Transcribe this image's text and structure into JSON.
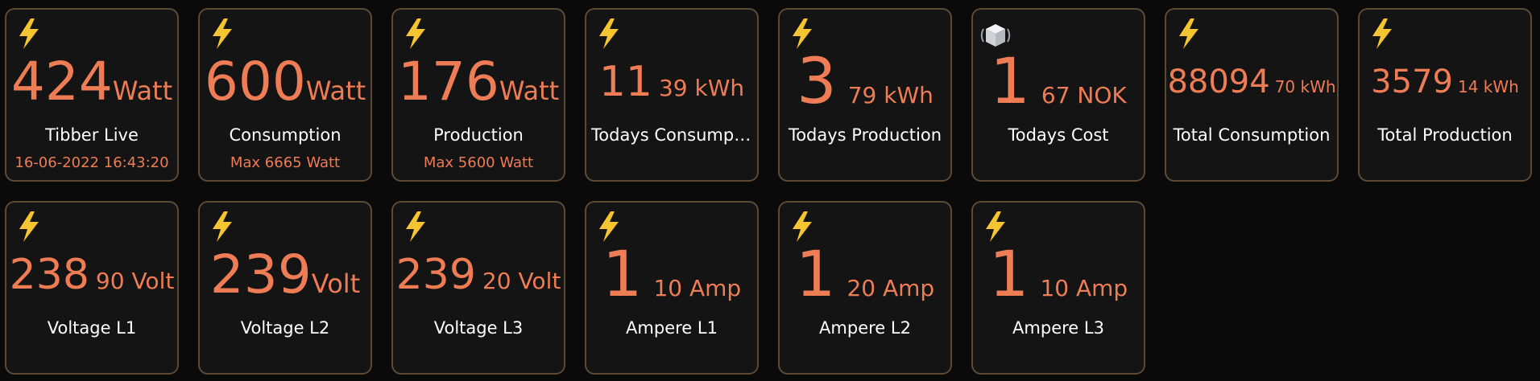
{
  "colors": {
    "background": "#0a0a0a",
    "tile_background": "#141414",
    "tile_border": "#5e4a34",
    "accent": "#ee7c55",
    "label": "#ffffff",
    "bolt": "#f5c531"
  },
  "tiles": [
    {
      "icon": "lightning-bolt-icon",
      "main": "424",
      "unit": "Watt",
      "label": "Tibber Live",
      "sub": "16-06-2022 16:43:20"
    },
    {
      "icon": "lightning-bolt-icon",
      "main": "600",
      "unit": "Watt",
      "label": "Consumption",
      "sub": "Max 6665 Watt"
    },
    {
      "icon": "lightning-bolt-icon",
      "main": "176",
      "unit": "Watt",
      "label": "Production",
      "sub": "Max 5600 Watt"
    },
    {
      "icon": "lightning-bolt-icon",
      "main": "11",
      "unit": "39 kWh",
      "label": "Todays Consumption"
    },
    {
      "icon": "lightning-bolt-icon",
      "main": "3",
      "unit": "79 kWh",
      "label": "Todays Production"
    },
    {
      "icon": "cube-device-icon",
      "main": "1",
      "unit": "67 NOK",
      "label": "Todays Cost"
    },
    {
      "icon": "lightning-bolt-icon",
      "main": "88094",
      "unit": "70 kWh",
      "label": "Total Consumption"
    },
    {
      "icon": "lightning-bolt-icon",
      "main": "3579",
      "unit": "14 kWh",
      "label": "Total Production"
    },
    {
      "icon": "lightning-bolt-icon",
      "main": "238",
      "unit": "90 Volt",
      "label": "Voltage L1"
    },
    {
      "icon": "lightning-bolt-icon",
      "main": "239",
      "unit": "Volt",
      "label": "Voltage L2"
    },
    {
      "icon": "lightning-bolt-icon",
      "main": "239",
      "unit": "20 Volt",
      "label": "Voltage L3"
    },
    {
      "icon": "lightning-bolt-icon",
      "main": "1",
      "unit": "10 Amp",
      "label": "Ampere L1"
    },
    {
      "icon": "lightning-bolt-icon",
      "main": "1",
      "unit": "20 Amp",
      "label": "Ampere L2"
    },
    {
      "icon": "lightning-bolt-icon",
      "main": "1",
      "unit": "10 Amp",
      "label": "Ampere L3"
    }
  ]
}
